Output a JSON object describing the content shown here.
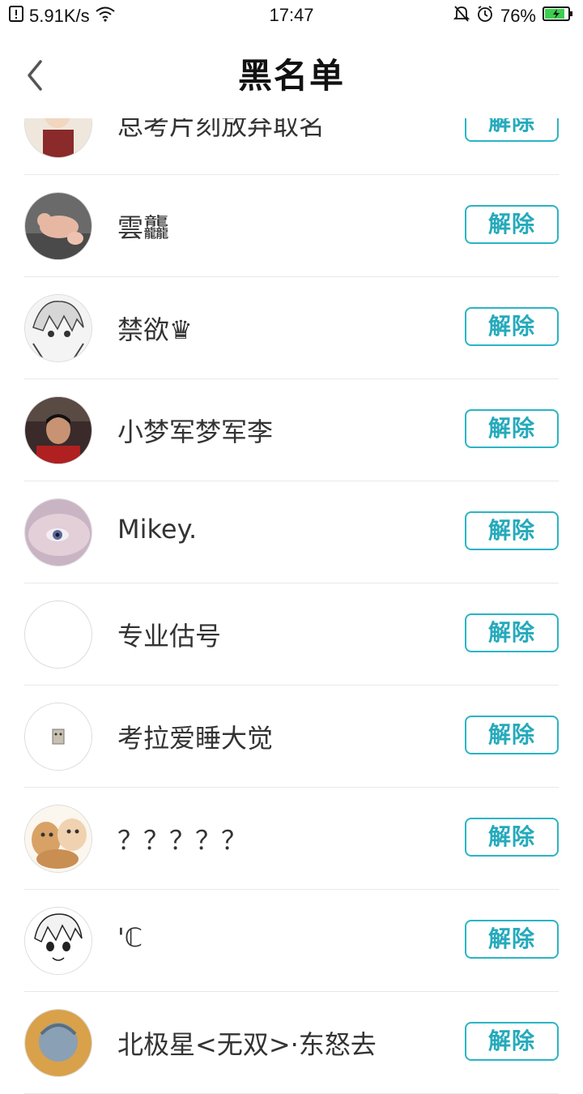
{
  "status_bar": {
    "net_speed": "5.91K/s",
    "time": "17:47",
    "battery": "76%",
    "icons": [
      "notification-icon",
      "wifi-icon",
      "mute-icon",
      "alarm-icon",
      "battery-icon"
    ]
  },
  "header": {
    "title": "黑名单",
    "back_icon": "back-chevron-icon"
  },
  "colors": {
    "accent": "#2bb4c4",
    "divider": "#e8e8e8"
  },
  "blocklist": {
    "items": [
      {
        "name": "总考片刻放弃取名",
        "button": "解除"
      },
      {
        "name": "雲龘",
        "button": "解除"
      },
      {
        "name": "禁欲♛",
        "button": "解除"
      },
      {
        "name": "小梦军梦军李",
        "button": "解除"
      },
      {
        "name": "Mikey.",
        "button": "解除"
      },
      {
        "name": "专业估号",
        "button": "解除"
      },
      {
        "name": "考拉爱睡大觉",
        "button": "解除"
      },
      {
        "name": "？？？？？",
        "button": "解除"
      },
      {
        "name": "'ℂ",
        "button": "解除"
      },
      {
        "name": "北极星<无双>·东怒去",
        "button": "解除"
      }
    ]
  }
}
